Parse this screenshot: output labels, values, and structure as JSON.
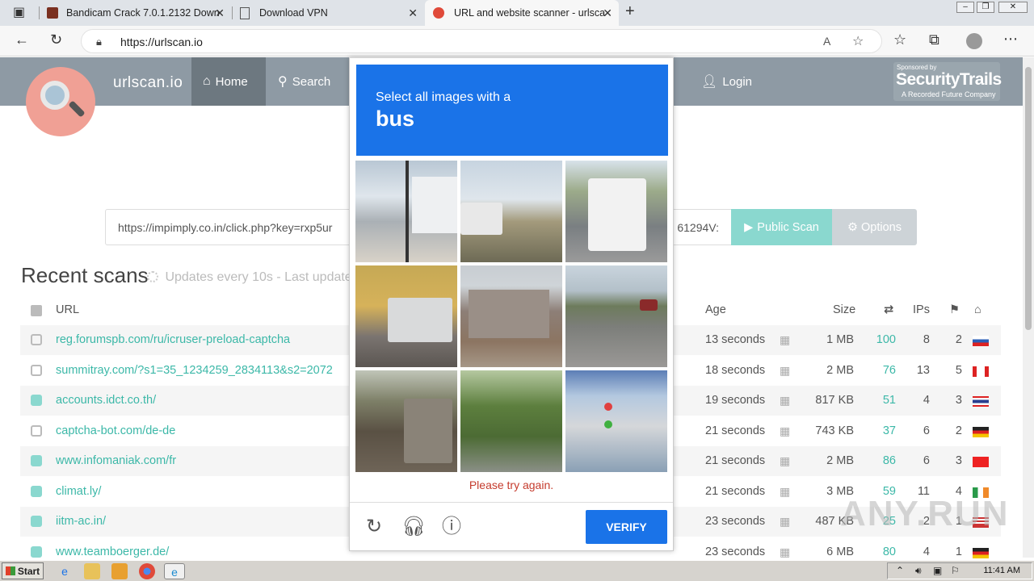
{
  "browser": {
    "tabs": [
      {
        "title": "Bandicam Crack 7.0.1.2132 Down"
      },
      {
        "title": "Download VPN"
      },
      {
        "title": "URL and website scanner - urlsca"
      }
    ],
    "address": "https://urlscan.io"
  },
  "site": {
    "brand": "urlscan.io",
    "nav": {
      "home": "Home",
      "search": "Search",
      "login": "Login"
    },
    "sponsor": {
      "line1": "Sponsored by",
      "name": "SecurityTrails",
      "line3": "A Recorded Future Company"
    },
    "search": {
      "value_left": "https://impimply.co.in/click.php?key=rxp5ur",
      "value_right": "61294V:"
    },
    "public_scan": "Public Scan",
    "options": "Options",
    "recent": {
      "title": "Recent scans",
      "subtitle": "Updates every 10s - Last update"
    },
    "headers": {
      "url": "URL",
      "age": "Age",
      "size": "Size",
      "ips": "IPs"
    },
    "rows": [
      {
        "url": "reg.forumspb.com/ru/icruser-preload-captcha",
        "age": "13 seconds",
        "size": "1 MB",
        "links": "100",
        "ips": "8",
        "flags": "2",
        "flag": "ru",
        "secure": false
      },
      {
        "url": "summitray.com/?s1=35_1234259_2834113&s2=2072",
        "age": "18 seconds",
        "size": "2 MB",
        "links": "76",
        "ips": "13",
        "flags": "5",
        "flag": "ca",
        "secure": false
      },
      {
        "url": "accounts.idct.co.th/",
        "age": "19 seconds",
        "size": "817 KB",
        "links": "51",
        "ips": "4",
        "flags": "3",
        "flag": "th",
        "secure": true
      },
      {
        "url": "captcha-bot.com/de-de",
        "age": "21 seconds",
        "size": "743 KB",
        "links": "37",
        "ips": "6",
        "flags": "2",
        "flag": "de",
        "secure": false
      },
      {
        "url": "www.infomaniak.com/fr",
        "age": "21 seconds",
        "size": "2 MB",
        "links": "86",
        "ips": "6",
        "flags": "3",
        "flag": "ch",
        "secure": true
      },
      {
        "url": "climat.ly/",
        "age": "21 seconds",
        "size": "3 MB",
        "links": "59",
        "ips": "11",
        "flags": "4",
        "flag": "ie",
        "secure": true
      },
      {
        "url": "iitm-ac.in/",
        "age": "23 seconds",
        "size": "487 KB",
        "links": "25",
        "ips": "2",
        "flags": "1",
        "flag": "us",
        "secure": true
      },
      {
        "url": "www.teamboerger.de/",
        "age": "23 seconds",
        "size": "6 MB",
        "links": "80",
        "ips": "4",
        "flags": "1",
        "flag": "de",
        "secure": true
      }
    ]
  },
  "captcha": {
    "prompt": "Select all images with a",
    "target": "bus",
    "error": "Please try again.",
    "verify": "VERIFY"
  },
  "watermark": "ANY.RUN",
  "taskbar": {
    "start": "Start",
    "clock": "11:41 AM"
  }
}
